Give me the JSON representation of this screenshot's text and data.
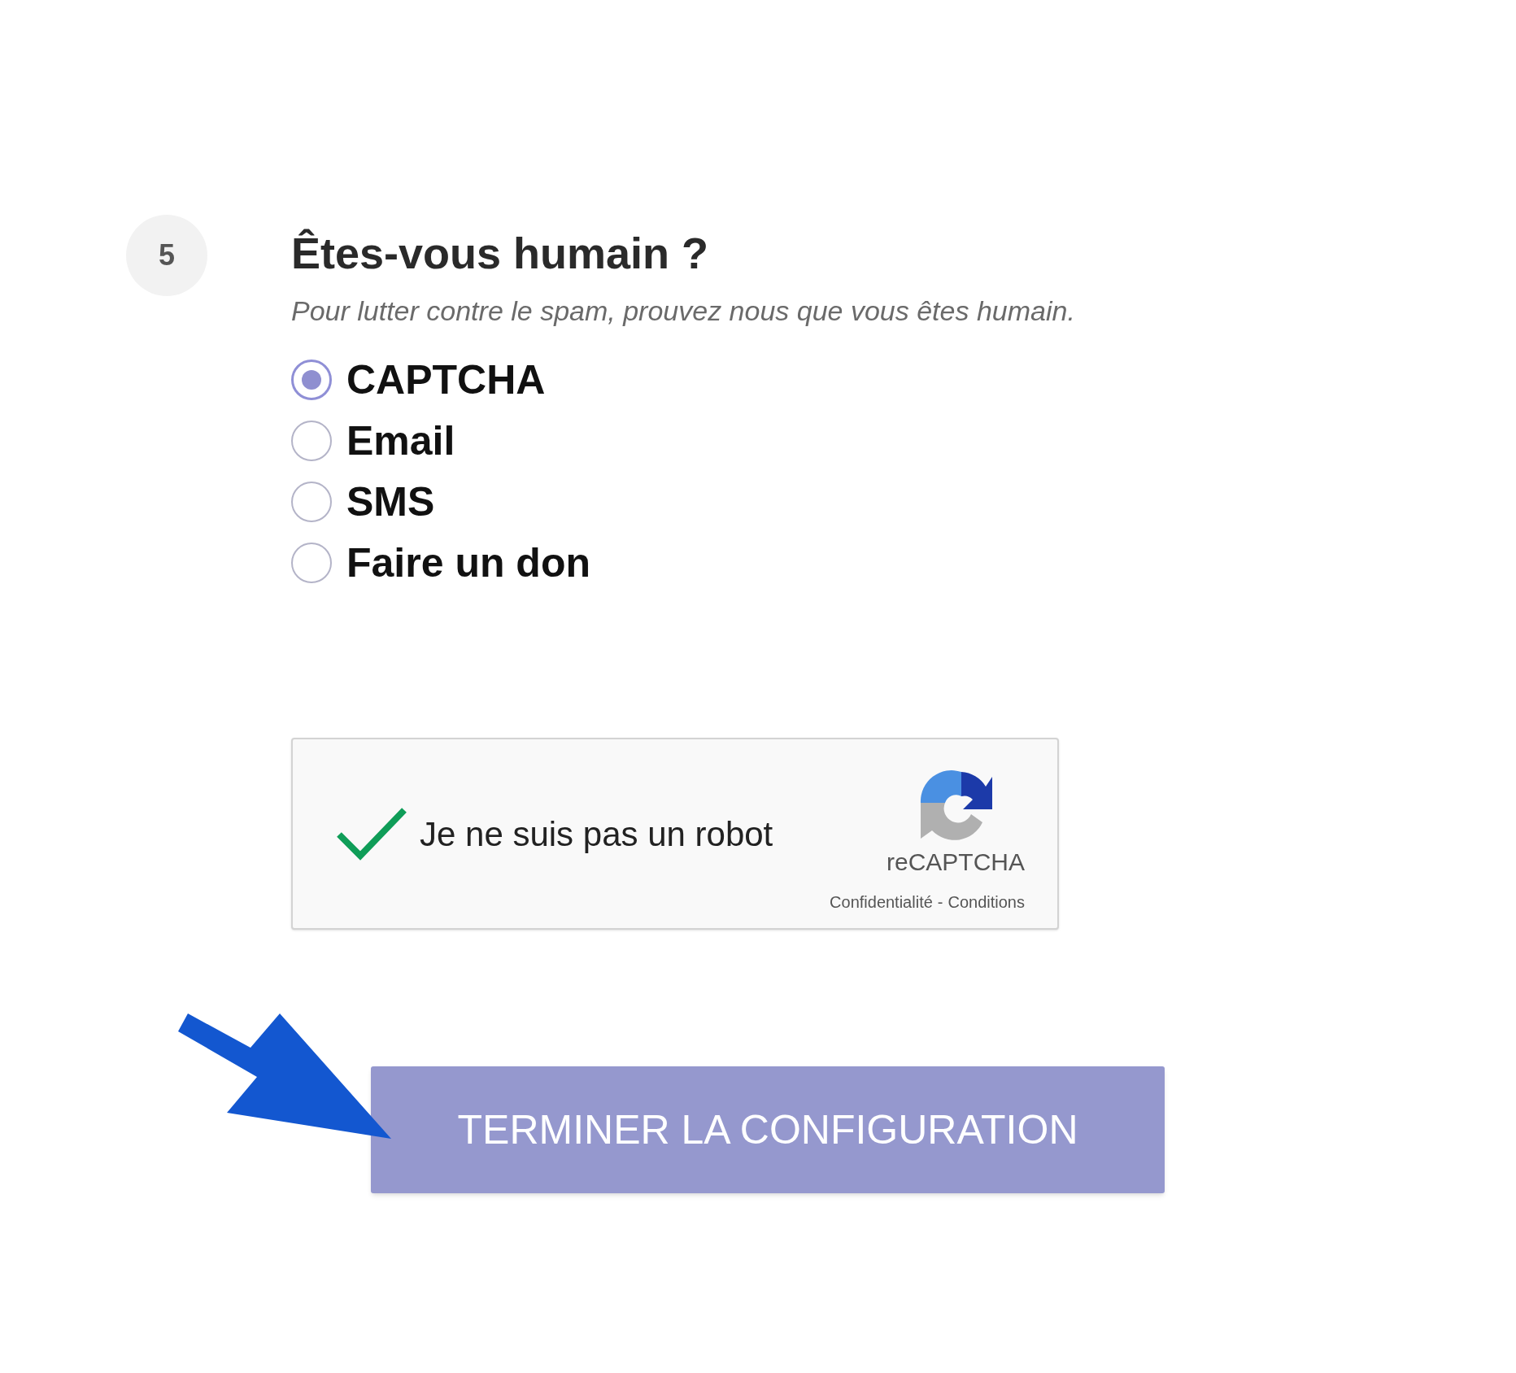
{
  "step": {
    "number": "5",
    "title": "Êtes-vous humain ?",
    "subtitle": "Pour lutter contre le spam, prouvez nous que vous êtes humain."
  },
  "options": [
    {
      "label": "CAPTCHA",
      "selected": true
    },
    {
      "label": "Email",
      "selected": false
    },
    {
      "label": "SMS",
      "selected": false
    },
    {
      "label": "Faire un don",
      "selected": false
    }
  ],
  "recaptcha": {
    "label": "Je ne suis pas un robot",
    "checked": true,
    "brand": "reCAPTCHA",
    "privacy": "Confidentialité",
    "separator": "-",
    "terms": "Conditions"
  },
  "submit": {
    "label": "TERMINER LA CONFIGURATION"
  }
}
